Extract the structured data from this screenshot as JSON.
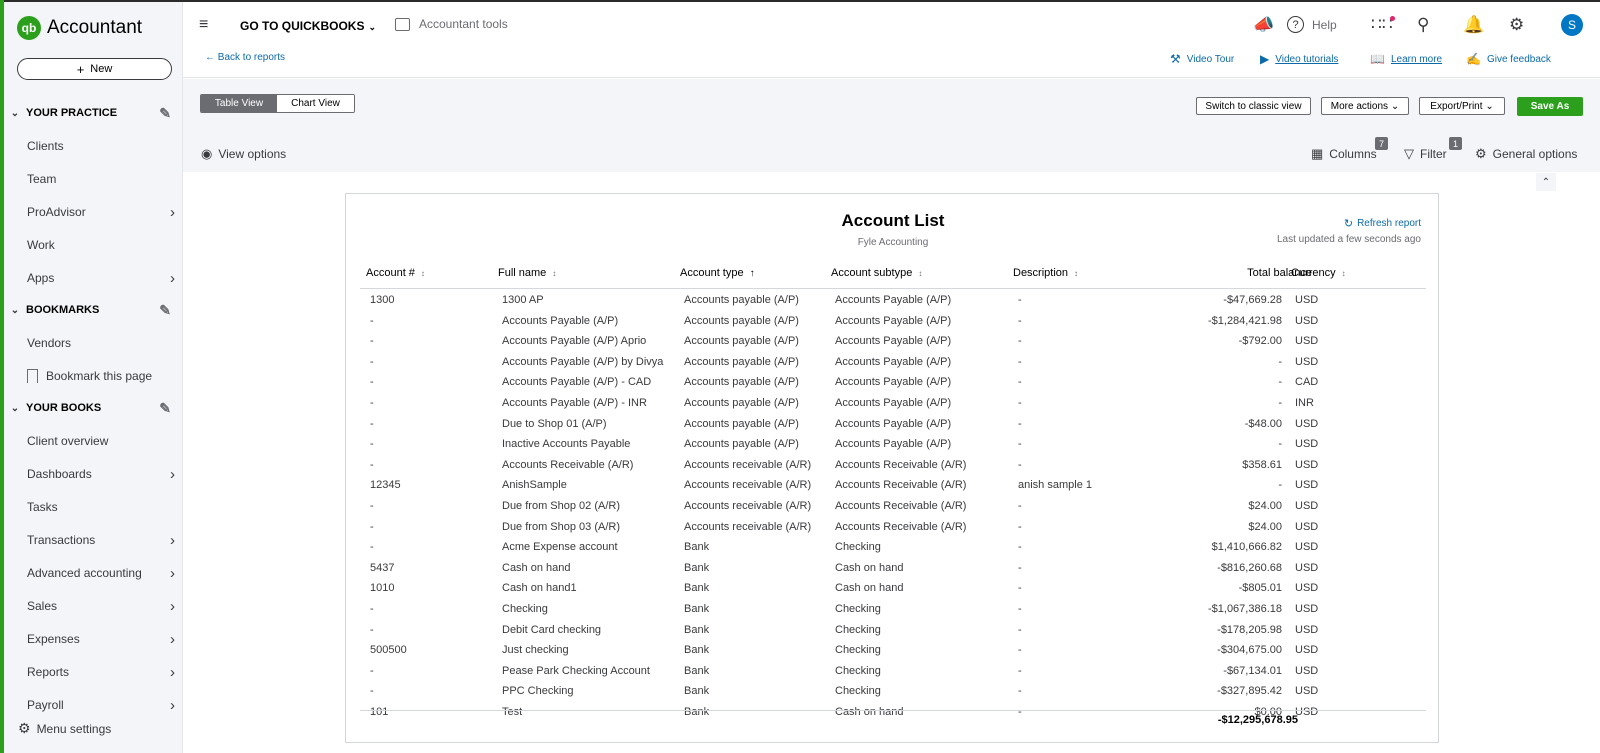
{
  "app": {
    "name": "Accountant",
    "logo_glyph": "qb",
    "avatar_initial": "S",
    "accent": "#2ca01c"
  },
  "sidebar": {
    "new_label": "New",
    "sections": {
      "practice": "YOUR PRACTICE",
      "bookmarks": "BOOKMARKS",
      "books": "YOUR BOOKS"
    },
    "practice_items": [
      "Clients",
      "Team",
      "ProAdvisor",
      "Work",
      "Apps"
    ],
    "bookmark_items": [
      "Vendors",
      "Bookmark this page"
    ],
    "book_items": [
      "Client overview",
      "Dashboards",
      "Tasks",
      "Transactions",
      "Advanced accounting",
      "Sales",
      "Expenses",
      "Reports",
      "Payroll"
    ],
    "menu_settings": "Menu settings"
  },
  "header": {
    "goto": "GO TO QUICKBOOKS",
    "tools": "Accountant tools",
    "help": "Help"
  },
  "links": {
    "back": "Back to reports",
    "video_tour": "Video Tour",
    "video_tutorials": "Video tutorials",
    "learn_more": "Learn more",
    "give_feedback": "Give feedback"
  },
  "toolbar": {
    "table_view": "Table View",
    "chart_view": "Chart View",
    "switch_classic": "Switch to classic view",
    "more_actions": "More actions",
    "export_print": "Export/Print",
    "save_as": "Save As",
    "view_options": "View options",
    "columns": "Columns",
    "columns_count": "7",
    "filter": "Filter",
    "filter_count": "1",
    "general_options": "General options"
  },
  "report": {
    "title": "Account List",
    "company": "Fyle Accounting",
    "refresh": "Refresh report",
    "last_updated": "Last updated a few seconds ago",
    "columns": [
      "Account #",
      "Full name",
      "Account type",
      "Account subtype",
      "Description",
      "Total balance",
      "Currency"
    ],
    "rows": [
      [
        "1300",
        "1300 AP",
        "Accounts payable (A/P)",
        "Accounts Payable (A/P)",
        "-",
        "-$47,669.28",
        "USD"
      ],
      [
        "-",
        "Accounts Payable (A/P)",
        "Accounts payable (A/P)",
        "Accounts Payable (A/P)",
        "-",
        "-$1,284,421.98",
        "USD"
      ],
      [
        "-",
        "Accounts Payable (A/P) Aprio",
        "Accounts payable (A/P)",
        "Accounts Payable (A/P)",
        "-",
        "-$792.00",
        "USD"
      ],
      [
        "-",
        "Accounts Payable (A/P) by Divya",
        "Accounts payable (A/P)",
        "Accounts Payable (A/P)",
        "-",
        "-",
        "USD"
      ],
      [
        "-",
        "Accounts Payable (A/P) - CAD",
        "Accounts payable (A/P)",
        "Accounts Payable (A/P)",
        "-",
        "-",
        "CAD"
      ],
      [
        "-",
        "Accounts Payable (A/P) - INR",
        "Accounts payable (A/P)",
        "Accounts Payable (A/P)",
        "-",
        "-",
        "INR"
      ],
      [
        "-",
        "Due to Shop 01 (A/P)",
        "Accounts payable (A/P)",
        "Accounts Payable (A/P)",
        "-",
        "-$48.00",
        "USD"
      ],
      [
        "-",
        "Inactive Accounts Payable",
        "Accounts payable (A/P)",
        "Accounts Payable (A/P)",
        "-",
        "-",
        "USD"
      ],
      [
        "-",
        "Accounts Receivable (A/R)",
        "Accounts receivable (A/R)",
        "Accounts Receivable (A/R)",
        "-",
        "$358.61",
        "USD"
      ],
      [
        "12345",
        "AnishSample",
        "Accounts receivable (A/R)",
        "Accounts Receivable (A/R)",
        "anish sample 1",
        "-",
        "USD"
      ],
      [
        "-",
        "Due from Shop 02 (A/R)",
        "Accounts receivable (A/R)",
        "Accounts Receivable (A/R)",
        "-",
        "$24.00",
        "USD"
      ],
      [
        "-",
        "Due from Shop 03 (A/R)",
        "Accounts receivable (A/R)",
        "Accounts Receivable (A/R)",
        "-",
        "$24.00",
        "USD"
      ],
      [
        "-",
        "Acme Expense account",
        "Bank",
        "Checking",
        "-",
        "$1,410,666.82",
        "USD"
      ],
      [
        "5437",
        "Cash on hand",
        "Bank",
        "Cash on hand",
        "-",
        "-$816,260.68",
        "USD"
      ],
      [
        "1010",
        "Cash on hand1",
        "Bank",
        "Cash on hand",
        "-",
        "-$805.01",
        "USD"
      ],
      [
        "-",
        "Checking",
        "Bank",
        "Checking",
        "-",
        "-$1,067,386.18",
        "USD"
      ],
      [
        "-",
        "Debit Card checking",
        "Bank",
        "Checking",
        "-",
        "-$178,205.98",
        "USD"
      ],
      [
        "500500",
        "Just checking",
        "Bank",
        "Checking",
        "-",
        "-$304,675.00",
        "USD"
      ],
      [
        "-",
        "Pease Park Checking Account",
        "Bank",
        "Checking",
        "-",
        "-$67,134.01",
        "USD"
      ],
      [
        "-",
        "PPC Checking",
        "Bank",
        "Checking",
        "-",
        "-$327,895.42",
        "USD"
      ],
      [
        "101",
        "Test",
        "Bank",
        "Cash on hand",
        "-",
        "$0.00",
        "USD"
      ]
    ],
    "total": "-$12,295,678.95"
  }
}
